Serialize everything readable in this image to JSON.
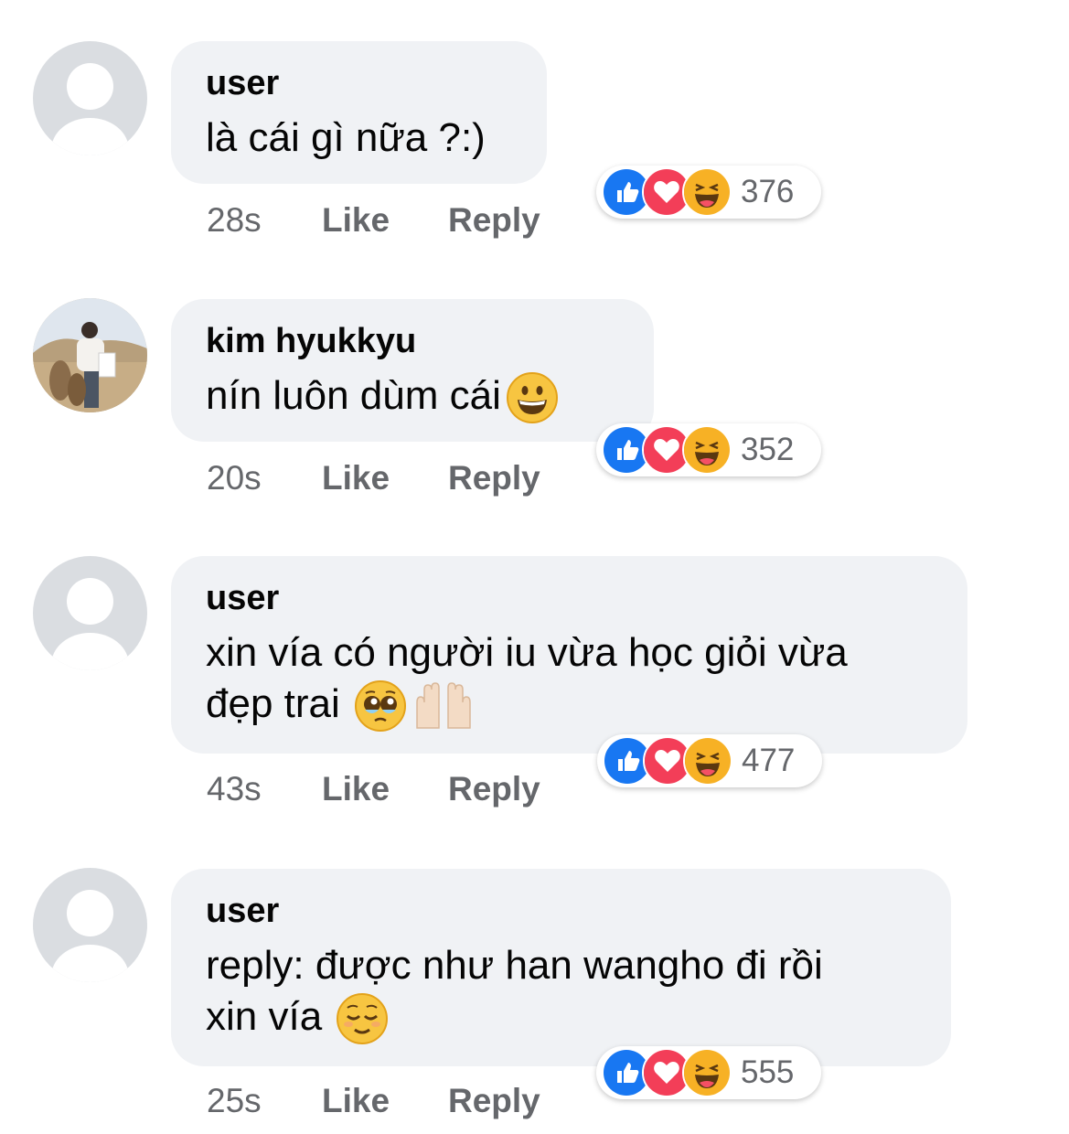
{
  "comments": [
    {
      "author": "user",
      "text": "là cái gì nữa ?:)",
      "time": "28s",
      "like": "Like",
      "reply": "Reply",
      "reactions": "376",
      "emoji": "",
      "avatar": "default-avatar"
    },
    {
      "author": "kim hyukkyu",
      "text": "nín luôn dùm cái",
      "time": "20s",
      "like": "Like",
      "reply": "Reply",
      "reactions": "352",
      "emoji": "grinning-face",
      "avatar": "photo-avatar"
    },
    {
      "author": "user",
      "text_line1": "xin vía có người iu vừa học giỏi vừa",
      "text_line2": "đẹp trai",
      "time": "43s",
      "like": "Like",
      "reply": "Reply",
      "reactions": "477",
      "emoji": "pleading-face, raised-hands",
      "avatar": "default-avatar"
    },
    {
      "author": "user",
      "text_line1": "reply: được như han wangho đi rồi",
      "text_line2": "xin vía",
      "time": "25s",
      "like": "Like",
      "reply": "Reply",
      "reactions": "555",
      "emoji": "relieved-face",
      "avatar": "default-avatar"
    }
  ],
  "colors": {
    "bubble": "#f0f2f5",
    "meta_text": "#65676b",
    "like_blue": "#1877f2",
    "love_red": "#f33e58",
    "haha_yellow": "#f7b125"
  },
  "reaction_icons": [
    "like-icon",
    "love-icon",
    "haha-icon"
  ]
}
